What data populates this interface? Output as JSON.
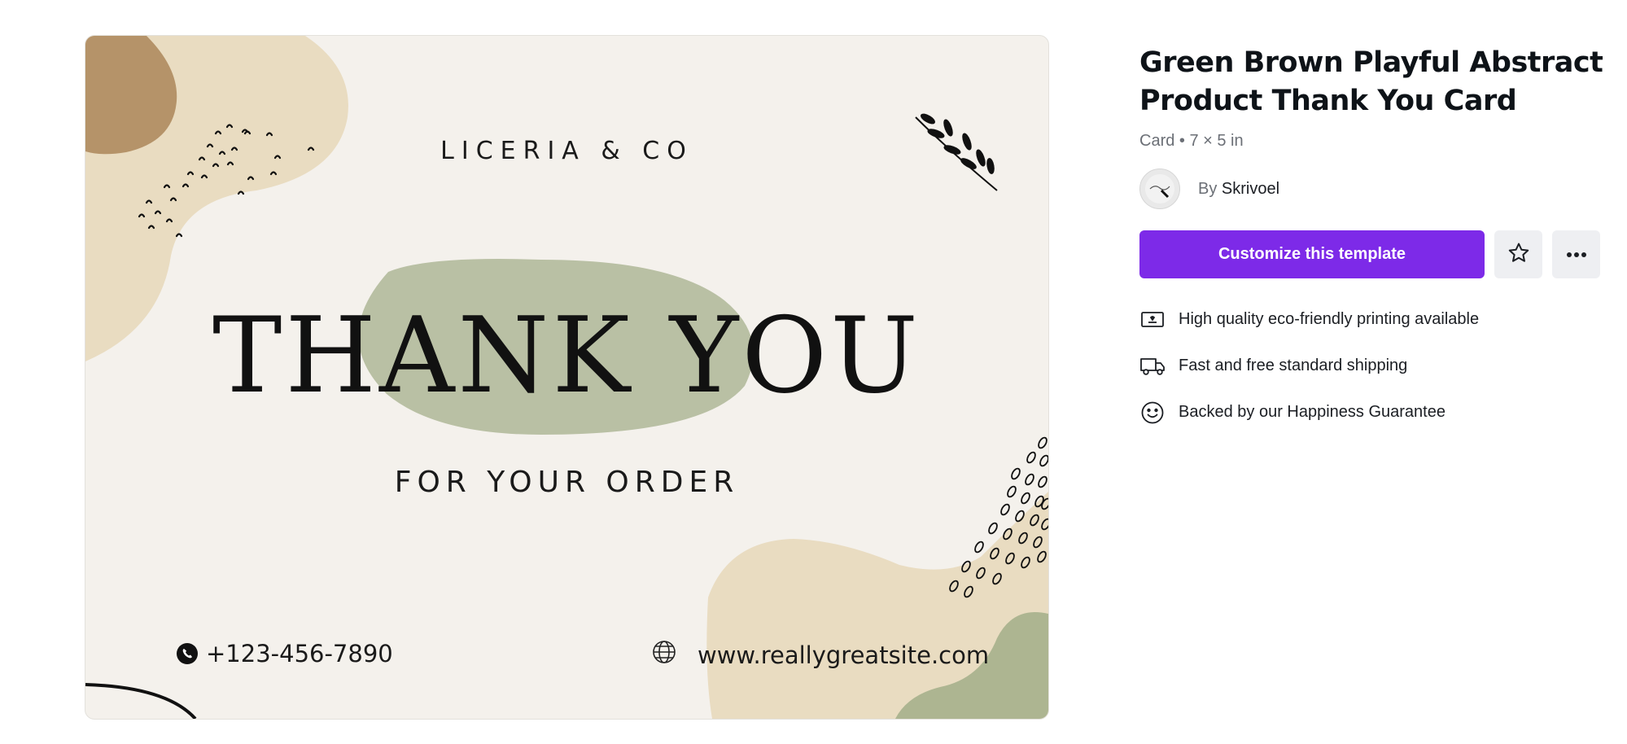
{
  "preview": {
    "brand": "LICERIA & CO",
    "headline": "THANK YOU",
    "subline": "FOR YOUR ORDER",
    "phone": "+123-456-7890",
    "website": "www.reallygreatsite.com",
    "colors": {
      "background": "#f4f1ec",
      "sand": "#e9dcc1",
      "brown": "#b59369",
      "sage": "#b9c0a4",
      "sage_dark": "#adb591"
    },
    "icons": [
      "phone-icon",
      "globe-icon",
      "leaf-sprig-icon"
    ]
  },
  "details": {
    "title": "Green Brown Playful Abstract Product Thank You Card",
    "meta": "Card • 7 × 5 in",
    "author_prefix": "By",
    "author_name": "Skrivoel",
    "customize_label": "Customize this template",
    "features": [
      {
        "icon": "printer-icon",
        "text": "High quality eco-friendly printing available"
      },
      {
        "icon": "truck-icon",
        "text": "Fast and free standard shipping"
      },
      {
        "icon": "smile-icon",
        "text": "Backed by our Happiness Guarantee"
      }
    ],
    "accent_color": "#7d2ae8"
  }
}
